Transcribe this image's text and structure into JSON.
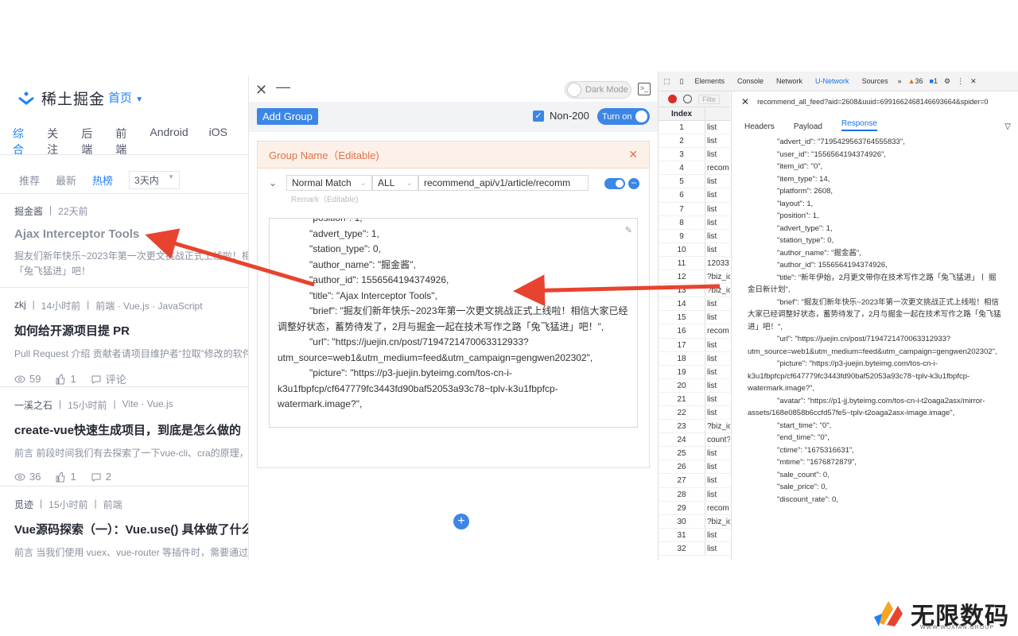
{
  "site": {
    "logo": "稀土掘金",
    "home_nav": "首页",
    "categories": [
      "综合",
      "关注",
      "后端",
      "前端",
      "Android",
      "iOS"
    ],
    "sub_tabs": [
      "推荐",
      "最新",
      "热榜"
    ],
    "range": "3天内",
    "articles": [
      {
        "author": "掘金酱",
        "time": "22天前",
        "tags": "",
        "title": "Ajax Interceptor Tools",
        "summary": "掘友们新年快乐~2023年第一次更文挑战正式上线啦！相信",
        "summary2": "「兔飞猛进」吧！",
        "views": "",
        "likes": "",
        "comments": ""
      },
      {
        "author": "zkj",
        "time": "14小时前",
        "tags": "前端 · Vue.js · JavaScript",
        "title": "如何给开源项目提 PR",
        "summary": "Pull Request 介绍 贡献者请项目维护者“拉取”修改的软件",
        "views": "59",
        "likes": "1",
        "comments": "评论"
      },
      {
        "author": "一溪之石",
        "time": "15小时前",
        "tags": "Vite · Vue.js",
        "title": "create-vue快速生成项目，到底是怎么做的",
        "summary": "前言 前段时间我们有去探索了一下vue-cli、cra的原理，今",
        "views": "36",
        "likes": "1",
        "comments": "2"
      },
      {
        "author": "觅迹",
        "time": "15小时前",
        "tags": "前端",
        "title": "Vue源码探索（一）：Vue.use() 具体做了什么",
        "summary": "前言 当我们使用 vuex、vue-router 等插件时，需要通过V",
        "views": "",
        "likes": "",
        "comments": ""
      }
    ]
  },
  "panel": {
    "dark_mode": "Dark Mode",
    "add_group": "Add Group",
    "non200": "Non-200",
    "turn_on": "Turn on",
    "group_name": "Group Name（Editable)",
    "match": "Normal Match",
    "method": "ALL",
    "url": "recommend_api/v1/article/recomm",
    "remark": "Remark（Editable)",
    "editor_lines": [
      "            \"position\": 1,",
      "            \"advert_type\": 1,",
      "            \"station_type\": 0,",
      "            \"author_name\": \"掘金酱\",",
      "            \"author_id\": 1556564194374926,",
      "            \"title\": \"Ajax Interceptor Tools\",",
      "            \"brief\": \"掘友们新年快乐~2023年第一次更文挑战正式上线啦！相信大家已经调整好状态，蓄势待发了，2月与掘金一起在技术写作之路「兔飞猛进」吧！\",",
      "            \"url\": \"https://juejin.cn/post/7194721470063312933?utm_source=web1&utm_medium=feed&utm_campaign=gengwen202302\",",
      "            \"picture\": \"https://p3-juejin.byteimg.com/tos-cn-i-k3u1fbpfcp/cf647779fc3443fd90baf52053a93c78~tplv-k3u1fbpfcp-watermark.image?\","
    ]
  },
  "devtools": {
    "tabs": [
      "Elements",
      "Console",
      "Network",
      "U-Network",
      "Sources"
    ],
    "active_tab": "U-Network",
    "warn_count": "36",
    "msg_count": "1",
    "filter": "Filte",
    "index_header": "Index",
    "rows": [
      {
        "i": "1",
        "n": "list"
      },
      {
        "i": "2",
        "n": "list"
      },
      {
        "i": "3",
        "n": "list"
      },
      {
        "i": "4",
        "n": "recom"
      },
      {
        "i": "5",
        "n": "list"
      },
      {
        "i": "6",
        "n": "list"
      },
      {
        "i": "7",
        "n": "list"
      },
      {
        "i": "8",
        "n": "list"
      },
      {
        "i": "9",
        "n": "list"
      },
      {
        "i": "10",
        "n": "list"
      },
      {
        "i": "11",
        "n": "12033"
      },
      {
        "i": "12",
        "n": "?biz_ic"
      },
      {
        "i": "13",
        "n": "?biz_ic"
      },
      {
        "i": "14",
        "n": "list"
      },
      {
        "i": "15",
        "n": "list"
      },
      {
        "i": "16",
        "n": "recom"
      },
      {
        "i": "17",
        "n": "list"
      },
      {
        "i": "18",
        "n": "list"
      },
      {
        "i": "19",
        "n": "list"
      },
      {
        "i": "20",
        "n": "list"
      },
      {
        "i": "21",
        "n": "list"
      },
      {
        "i": "22",
        "n": "list"
      },
      {
        "i": "23",
        "n": "?biz_ic"
      },
      {
        "i": "24",
        "n": "count?"
      },
      {
        "i": "25",
        "n": "list"
      },
      {
        "i": "26",
        "n": "list"
      },
      {
        "i": "27",
        "n": "list"
      },
      {
        "i": "28",
        "n": "list"
      },
      {
        "i": "29",
        "n": "recom"
      },
      {
        "i": "30",
        "n": "?biz_ic"
      },
      {
        "i": "31",
        "n": "list"
      },
      {
        "i": "32",
        "n": "list"
      }
    ],
    "request_url": "recommend_all_feed?aid=2608&uuid=6991662468146693664&spider=0",
    "detail_tabs": [
      "Headers",
      "Payload",
      "Response"
    ],
    "detail_active": "Response",
    "response_lines": [
      "              \"advert_id\": \"7195429563764555833\",",
      "              \"user_id\": \"1556564194374926\",",
      "              \"item_id\": \"0\",",
      "              \"item_type\": 14,",
      "              \"platform\": 2608,",
      "              \"layout\": 1,",
      "              \"position\": 1,",
      "              \"advert_type\": 1,",
      "              \"station_type\": 0,",
      "              \"author_name\": \"掘金酱\",",
      "              \"author_id\": 1556564194374926,",
      "              \"title\": \"新年伊始，2月更文带你在技术写作之路「兔飞猛进」丨 掘金日新计划\",",
      "              \"brief\": \"掘友们新年快乐~2023年第一次更文挑战正式上线啦！相信大家已经调整好状态，蓄势待发了，2月与掘金一起在技术写作之路「兔飞猛进」吧！\",",
      "              \"url\": \"https://juejin.cn/post/7194721470063312933?utm_source=web1&utm_medium=feed&utm_campaign=gengwen202302\",",
      "              \"picture\": \"https://p3-juejin.byteimg.com/tos-cn-i-k3u1fbpfcp/cf647779fc3443fd90baf52053a93c78~tplv-k3u1fbpfcp-watermark.image?\",",
      "              \"avatar\": \"https://p1-jj.byteimg.com/tos-cn-i-t2oaga2asx/mirror-assets/168e0858b6ccfd57fe5~tplv-t2oaga2asx-image.image\",",
      "              \"start_time\": \"0\",",
      "              \"end_time\": \"0\",",
      "              \"ctime\": \"1675316631\",",
      "              \"mtime\": \"1676872879\",",
      "              \"sale_count\": 0,",
      "              \"sale_price\": 0,",
      "              \"discount_rate\": 0,"
    ]
  },
  "watermark": {
    "text": "无限数码",
    "sub": "WWW.WUXIAN.GROUP"
  },
  "colors": {
    "accent": "#1e80ff",
    "panel_blue": "#3b86e6",
    "arrow": "#e8432e"
  }
}
